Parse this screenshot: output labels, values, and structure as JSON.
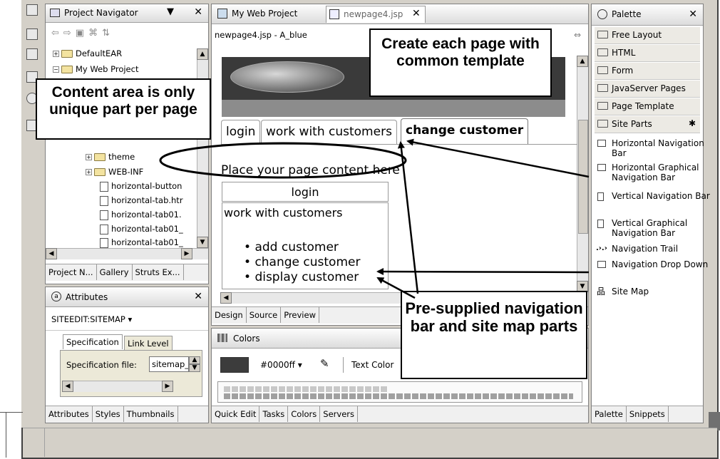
{
  "navigator": {
    "title": "Project Navigator",
    "tree": [
      "DefaultEAR",
      "My Web Project",
      "theme",
      "WEB-INF",
      "horizontal-button",
      "horizontal-tab.htr",
      "horizontal-tab01.",
      "horizontal-tab01_",
      "horizontal-tab01_"
    ],
    "tabs": [
      "Project N...",
      "Gallery",
      "Struts Ex..."
    ]
  },
  "attributes": {
    "title": "Attributes",
    "selector": "SITEEDIT:SITEMAP",
    "tabs": [
      "Specification",
      "Link Level"
    ],
    "spec_label": "Specification file:",
    "spec_value": "sitemap_",
    "bottom_tabs": [
      "Attributes",
      "Styles",
      "Thumbnails"
    ]
  },
  "editor": {
    "tabs": [
      "My Web Project",
      "newpage4.jsp"
    ],
    "path": "newpage4.jsp - A_blue",
    "nav_tabs": [
      "login",
      "work with customers",
      "change customer"
    ],
    "placeholder": "Place your page content here",
    "side_login": "login",
    "side_work": "work with customers",
    "bullets": [
      "add customer",
      "change customer",
      "display customer"
    ],
    "view_tabs": [
      "Design",
      "Source",
      "Preview"
    ]
  },
  "colors": {
    "title": "Colors",
    "value": "#0000ff",
    "text_color_label": "Text Color",
    "swatch": "#3c3c3c",
    "bottom_tabs": [
      "Quick Edit",
      "Tasks",
      "Colors",
      "Servers"
    ]
  },
  "palette": {
    "title": "Palette",
    "drawers": [
      "Free Layout",
      "HTML",
      "Form",
      "JavaServer Pages",
      "Page Template",
      "Site Parts"
    ],
    "parts": [
      "Horizontal Navigation Bar",
      "Horizontal Graphical Navigation Bar",
      "Vertical Navigation Bar",
      "Vertical Graphical Navigation Bar",
      "Navigation Trail",
      "Navigation Drop Down",
      "Site Map"
    ],
    "bottom_tabs": [
      "Palette",
      "Snippets"
    ]
  },
  "callouts": {
    "template": "Create each page with common template",
    "content": "Content area is only unique part per page",
    "parts": "Pre-supplied navigation bar and site map parts"
  }
}
